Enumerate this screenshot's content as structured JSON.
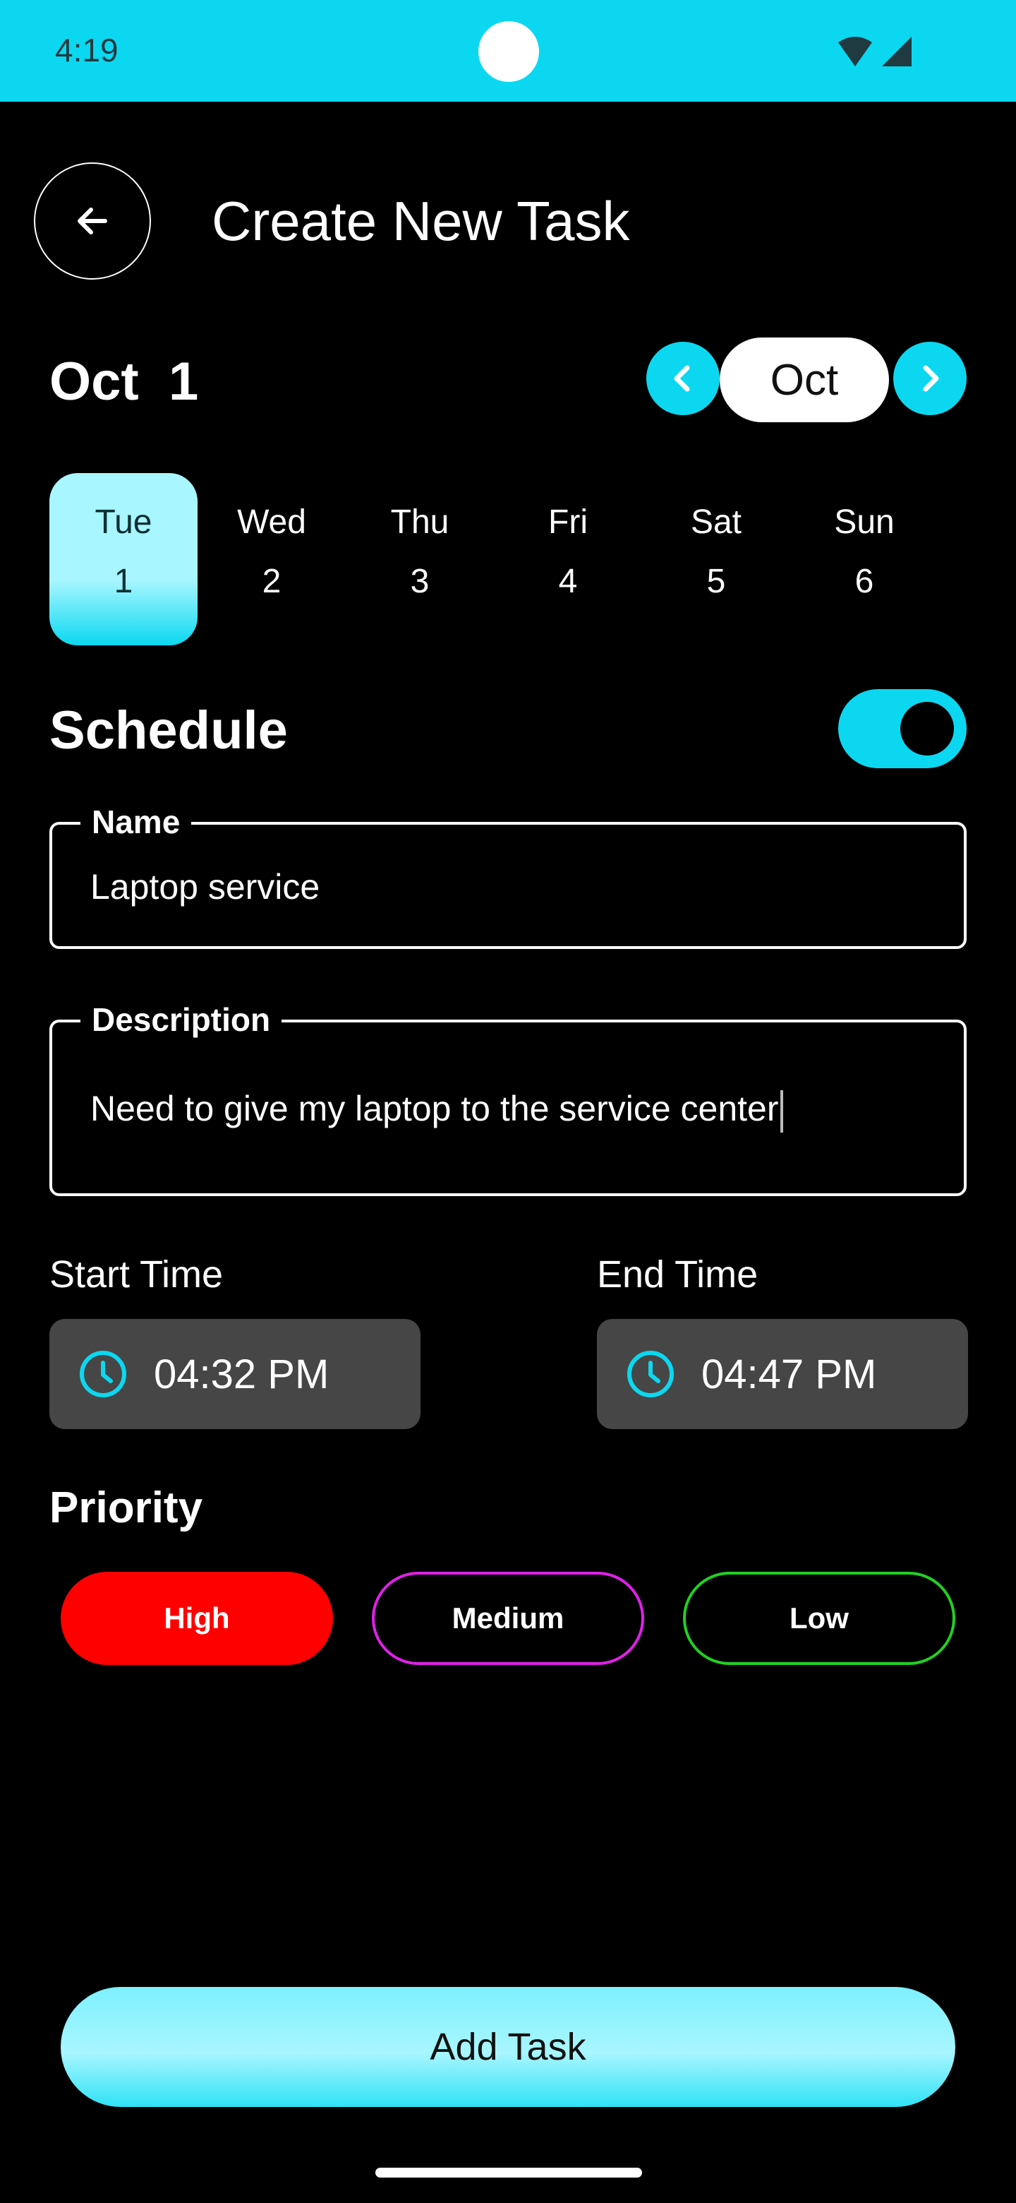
{
  "status_bar": {
    "time": "4:19",
    "background": "#0BD8F0"
  },
  "header": {
    "back_icon": "arrow-left-icon",
    "title": "Create New Task"
  },
  "date": {
    "month": "Oct",
    "day": "1",
    "month_selector": "Oct"
  },
  "days": [
    {
      "name": "Tue",
      "num": "1",
      "selected": true
    },
    {
      "name": "Wed",
      "num": "2",
      "selected": false
    },
    {
      "name": "Thu",
      "num": "3",
      "selected": false
    },
    {
      "name": "Fri",
      "num": "4",
      "selected": false
    },
    {
      "name": "Sat",
      "num": "5",
      "selected": false
    },
    {
      "name": "Sun",
      "num": "6",
      "selected": false
    }
  ],
  "schedule": {
    "title": "Schedule",
    "enabled": true
  },
  "name_field": {
    "label": "Name",
    "value": "Laptop service"
  },
  "description_field": {
    "label": "Description",
    "value": "Need to give my laptop to the service center"
  },
  "start_time": {
    "label": "Start Time",
    "value": "04:32 PM"
  },
  "end_time": {
    "label": "End Time",
    "value": "04:47 PM"
  },
  "priority": {
    "title": "Priority",
    "options": [
      {
        "label": "High",
        "color": "#FF0000",
        "selected": true
      },
      {
        "label": "Medium",
        "color": "#E020E8",
        "selected": false
      },
      {
        "label": "Low",
        "color": "#22D022",
        "selected": false
      }
    ]
  },
  "add_button": {
    "label": "Add Task"
  },
  "colors": {
    "accent": "#0BD8F0",
    "accent_light": "#A8F6FF",
    "background": "#000000",
    "time_box": "#464646"
  }
}
